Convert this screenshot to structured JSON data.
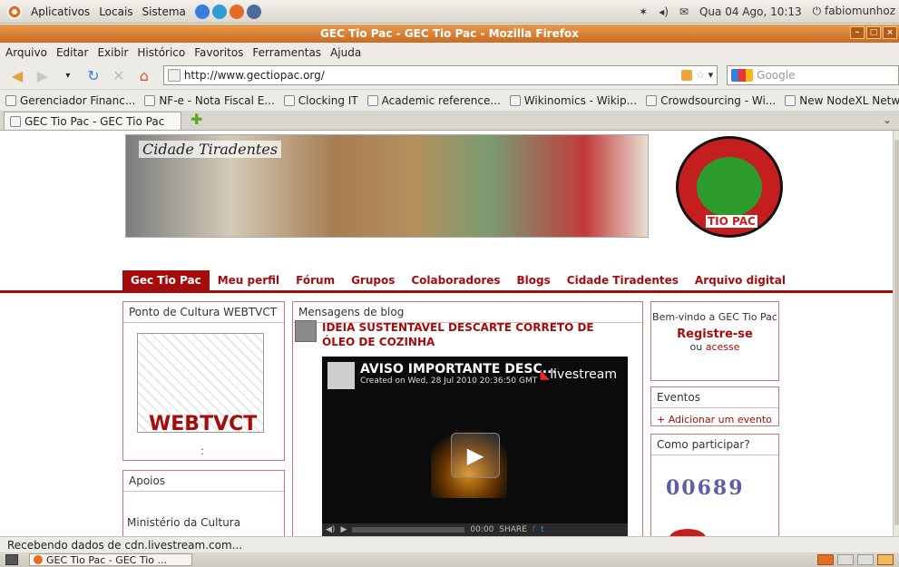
{
  "top_panel": {
    "menus": [
      "Aplicativos",
      "Locais",
      "Sistema"
    ],
    "clock": "Qua 04 Ago, 10:13",
    "user": "fabiomunhoz"
  },
  "window": {
    "title": "GEC Tio Pac - GEC Tio Pac - Mozilla Firefox"
  },
  "menubar": [
    "Arquivo",
    "Editar",
    "Exibir",
    "Histórico",
    "Favoritos",
    "Ferramentas",
    "Ajuda"
  ],
  "navbar": {
    "url": "http://www.gectiopac.org/",
    "search_placeholder": "Google"
  },
  "bookmarks": [
    "Gerenciador Financ...",
    "NF-e - Nota Fiscal E...",
    "Clocking IT",
    "Academic reference...",
    "Wikinomics - Wikip...",
    "Crowdsourcing - Wi...",
    "New NodeXL Netwo..."
  ],
  "tab": {
    "title": "GEC Tio Pac - GEC Tio Pac"
  },
  "page": {
    "banner_text": "Cidade Tiradentes",
    "logo_text": "TIO PAC",
    "nav": [
      "Gec Tio Pac",
      "Meu perfil",
      "Fórum",
      "Grupos",
      "Colaboradores",
      "Blogs",
      "Cidade Tiradentes",
      "Arquivo digital"
    ],
    "left": {
      "box1_title": "Ponto de Cultura WEBTVCT",
      "webtv_label": "WEBTVCT",
      "colon": ":",
      "box2_title": "Apoios",
      "apoios_item": "Ministério da Cultura"
    },
    "center": {
      "title": "Mensagens de blog",
      "post_title": "IDEIA SUSTENTAVEL DESCARTE CORRETO DE ÓLEO DE COZINHA",
      "video_title": "AVISO IMPORTANTE DESC...",
      "video_sub": "Created on Wed, 28 Jul 2010 20:36:50 GMT",
      "video_brand": "livestream",
      "video_time": "00:00",
      "share": "SHARE"
    },
    "right": {
      "welcome": "Bem-vindo a GEC Tio Pac",
      "register": "Registre-se",
      "or": "ou",
      "login": "acesse",
      "events_title": "Eventos",
      "add_event": "Adicionar um evento",
      "participate_title": "Como participar?",
      "counter": "00689"
    }
  },
  "statusbar": {
    "text": "Recebendo dados de cdn.livestream.com..."
  },
  "taskbar": {
    "window_button": "GEC Tio Pac - GEC Tio ..."
  }
}
